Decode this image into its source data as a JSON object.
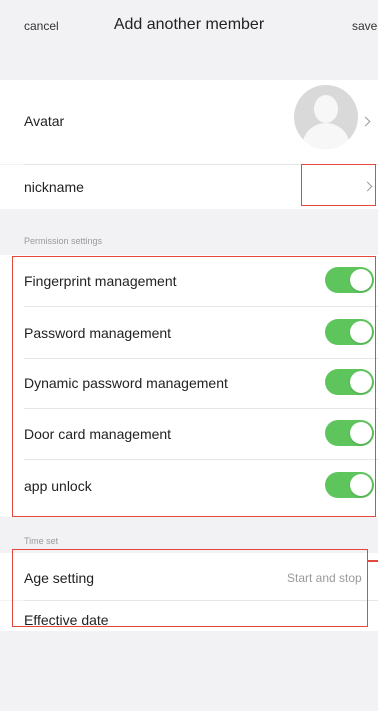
{
  "header": {
    "cancel_label": "cancel",
    "title": "Add another member",
    "save_label": "save"
  },
  "profile": {
    "avatar_label": "Avatar",
    "nickname_label": "nickname"
  },
  "permissions": {
    "section_label": "Permission settings",
    "items": [
      {
        "label": "Fingerprint management",
        "enabled": true
      },
      {
        "label": "Password management",
        "enabled": true
      },
      {
        "label": "Dynamic password management",
        "enabled": true
      },
      {
        "label": "Door card management",
        "enabled": true
      },
      {
        "label": "app unlock",
        "enabled": true
      }
    ]
  },
  "time": {
    "section_label": "Time set",
    "age_setting_label": "Age setting",
    "age_setting_value": "Start and stop",
    "effective_date_label": "Effective date"
  },
  "colors": {
    "toggle_on": "#5ec55d",
    "annotation_red": "#e4473c"
  }
}
